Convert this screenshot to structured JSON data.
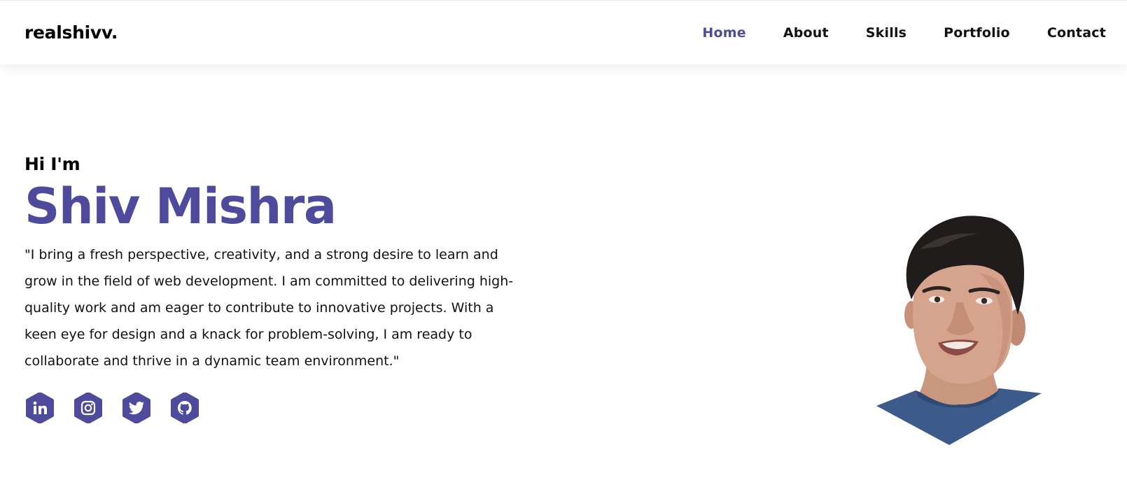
{
  "header": {
    "logo": "realshivv.",
    "nav": [
      {
        "label": "Home",
        "active": true
      },
      {
        "label": "About",
        "active": false
      },
      {
        "label": "Skills",
        "active": false
      },
      {
        "label": "Portfolio",
        "active": false
      },
      {
        "label": "Contact",
        "active": false
      }
    ]
  },
  "hero": {
    "greeting": "Hi I'm",
    "name": "Shiv Mishra",
    "bio": "\"I bring a fresh perspective, creativity, and a strong desire to learn and grow in the field of web development. I am committed to delivering high-quality work and am eager to contribute to innovative projects. With a keen eye for design and a knack for problem-solving, I am ready to collaborate and thrive in a dynamic team environment.\"",
    "socials": [
      {
        "icon": "linkedin-icon"
      },
      {
        "icon": "instagram-icon"
      },
      {
        "icon": "twitter-icon"
      },
      {
        "icon": "github-icon"
      }
    ]
  },
  "colors": {
    "accent": "#4e4b9c",
    "text": "#000000",
    "background": "#ffffff"
  }
}
